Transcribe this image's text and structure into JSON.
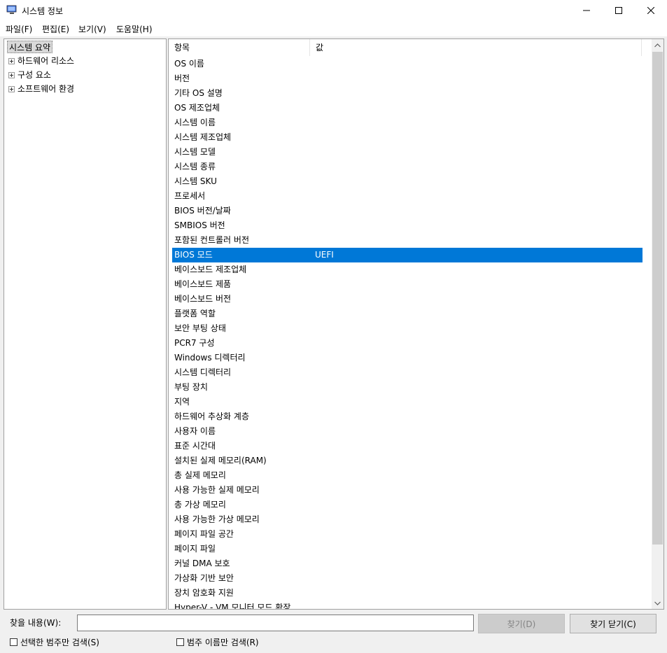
{
  "window": {
    "title": "시스템 정보",
    "controls": {
      "minimize": "─",
      "maximize": "☐",
      "close": "✕"
    }
  },
  "menu": [
    "파일(F)",
    "편집(E)",
    "보기(V)",
    "도움말(H)"
  ],
  "tree": {
    "root": "시스템 요약",
    "children": [
      "하드웨어 리소스",
      "구성 요소",
      "소프트웨어 환경"
    ]
  },
  "list": {
    "columns": [
      "항목",
      "값"
    ],
    "rows": [
      {
        "item": "OS 이름",
        "value": ""
      },
      {
        "item": "버전",
        "value": ""
      },
      {
        "item": "기타 OS 설명",
        "value": ""
      },
      {
        "item": "OS 제조업체",
        "value": ""
      },
      {
        "item": "시스템 이름",
        "value": ""
      },
      {
        "item": "시스템 제조업체",
        "value": ""
      },
      {
        "item": "시스템 모델",
        "value": ""
      },
      {
        "item": "시스템 종류",
        "value": ""
      },
      {
        "item": "시스템 SKU",
        "value": ""
      },
      {
        "item": "프로세서",
        "value": ""
      },
      {
        "item": "BIOS 버전/날짜",
        "value": ""
      },
      {
        "item": "SMBIOS 버전",
        "value": ""
      },
      {
        "item": "포함된 컨트롤러 버전",
        "value": ""
      },
      {
        "item": "BIOS 모드",
        "value": "UEFI"
      },
      {
        "item": "베이스보드 제조업체",
        "value": ""
      },
      {
        "item": "베이스보드 제품",
        "value": ""
      },
      {
        "item": "베이스보드 버전",
        "value": ""
      },
      {
        "item": "플랫폼 역할",
        "value": ""
      },
      {
        "item": "보안 부팅 상태",
        "value": ""
      },
      {
        "item": "PCR7 구성",
        "value": ""
      },
      {
        "item": "Windows 디렉터리",
        "value": ""
      },
      {
        "item": "시스템 디렉터리",
        "value": ""
      },
      {
        "item": "부팅 장치",
        "value": ""
      },
      {
        "item": "지역",
        "value": ""
      },
      {
        "item": "하드웨어 추상화 계층",
        "value": ""
      },
      {
        "item": "사용자 이름",
        "value": ""
      },
      {
        "item": "표준 시간대",
        "value": ""
      },
      {
        "item": "설치된 실제 메모리(RAM)",
        "value": ""
      },
      {
        "item": "총 실제 메모리",
        "value": ""
      },
      {
        "item": "사용 가능한 실제 메모리",
        "value": ""
      },
      {
        "item": "총 가상 메모리",
        "value": ""
      },
      {
        "item": "사용 가능한 가상 메모리",
        "value": ""
      },
      {
        "item": "페이지 파일 공간",
        "value": ""
      },
      {
        "item": "페이지 파일",
        "value": ""
      },
      {
        "item": "커널 DMA 보호",
        "value": ""
      },
      {
        "item": "가상화 기반 보안",
        "value": ""
      },
      {
        "item": "장치 암호화 지원",
        "value": ""
      },
      {
        "item": "Hyper-V - VM 모니터 모드 확장",
        "value": ""
      }
    ],
    "selected_index": 13
  },
  "find": {
    "label": "찾을 내용(W):",
    "input_value": "",
    "find_button": "찾기(D)",
    "close_button": "찾기 닫기(C)",
    "checkbox_selected_category": "선택한 범주만 검색(S)",
    "checkbox_category_names": "범주 이름만 검색(R)"
  },
  "colors": {
    "selection": "#0078d7",
    "window_bg": "#f0f0f0"
  }
}
